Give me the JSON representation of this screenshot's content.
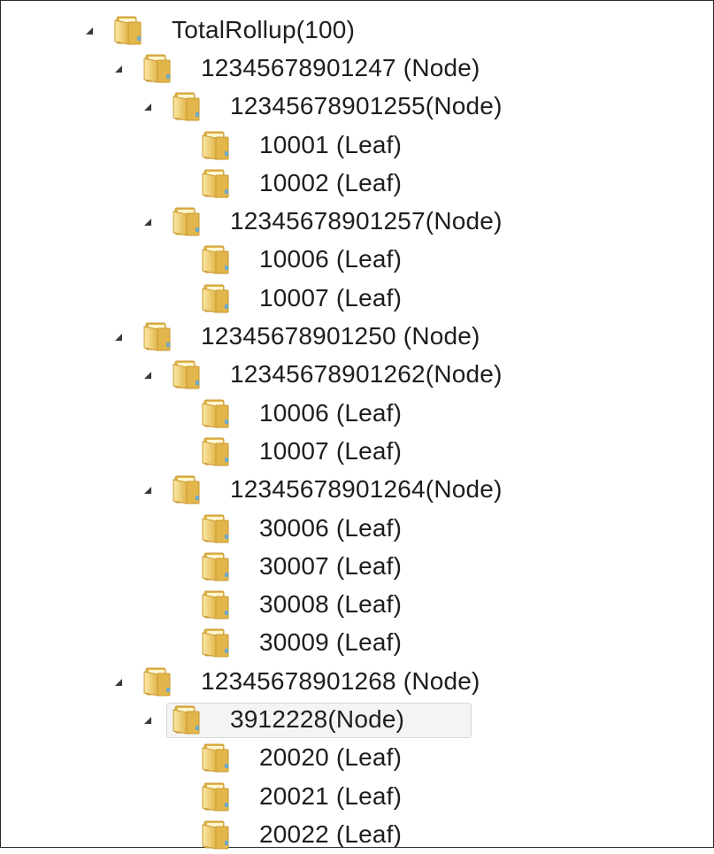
{
  "tree": {
    "items": [
      {
        "label": "TotalRollup(100)",
        "level": 0,
        "type": "node",
        "expanded": true
      },
      {
        "label": "12345678901247 (Node)",
        "level": 1,
        "type": "node",
        "expanded": true
      },
      {
        "label": "12345678901255(Node)",
        "level": 2,
        "type": "node",
        "expanded": true
      },
      {
        "label": "10001 (Leaf)",
        "level": 3,
        "type": "leaf"
      },
      {
        "label": "10002 (Leaf)",
        "level": 3,
        "type": "leaf"
      },
      {
        "label": "12345678901257(Node)",
        "level": 2,
        "type": "node",
        "expanded": true
      },
      {
        "label": "10006 (Leaf)",
        "level": 3,
        "type": "leaf"
      },
      {
        "label": "10007 (Leaf)",
        "level": 3,
        "type": "leaf"
      },
      {
        "label": "12345678901250 (Node)",
        "level": 1,
        "type": "node",
        "expanded": true
      },
      {
        "label": "12345678901262(Node)",
        "level": 2,
        "type": "node",
        "expanded": true
      },
      {
        "label": "10006 (Leaf)",
        "level": 3,
        "type": "leaf"
      },
      {
        "label": "10007 (Leaf)",
        "level": 3,
        "type": "leaf"
      },
      {
        "label": "12345678901264(Node)",
        "level": 2,
        "type": "node",
        "expanded": true
      },
      {
        "label": "30006 (Leaf)",
        "level": 3,
        "type": "leaf"
      },
      {
        "label": "30007 (Leaf)",
        "level": 3,
        "type": "leaf"
      },
      {
        "label": "30008 (Leaf)",
        "level": 3,
        "type": "leaf"
      },
      {
        "label": "30009 (Leaf)",
        "level": 3,
        "type": "leaf"
      },
      {
        "label": "12345678901268 (Node)",
        "level": 1,
        "type": "node",
        "expanded": true
      },
      {
        "label": "3912228(Node)",
        "level": 2,
        "type": "node",
        "expanded": true,
        "selected": true
      },
      {
        "label": "20020 (Leaf)",
        "level": 3,
        "type": "leaf"
      },
      {
        "label": "20021 (Leaf)",
        "level": 3,
        "type": "leaf"
      },
      {
        "label": "20022 (Leaf)",
        "level": 3,
        "type": "leaf"
      }
    ]
  },
  "icons": {
    "folder": "folder-icon",
    "expander": "expanded-arrow-icon"
  },
  "colors": {
    "folder_light": "#fbe9a8",
    "folder_dark": "#e2b64b",
    "folder_edge": "#c9982f",
    "text": "#1e1e1e",
    "selection_bg": "#f4f4f4",
    "selection_border": "#d8d8d8"
  }
}
